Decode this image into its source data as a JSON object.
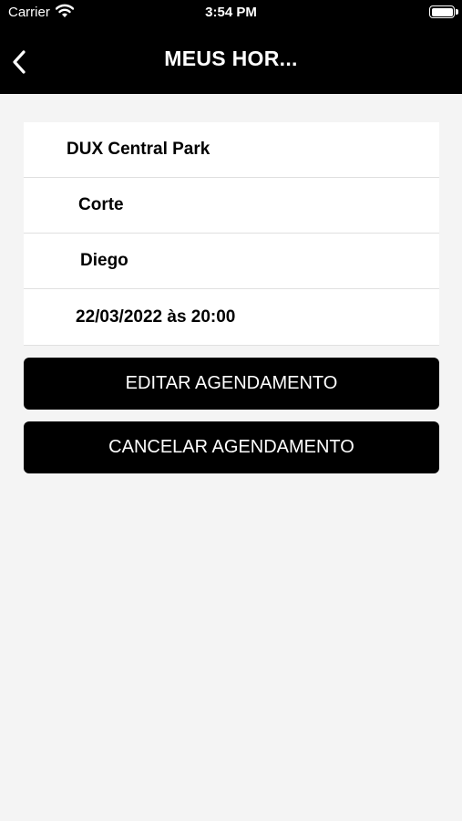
{
  "status_bar": {
    "carrier": "Carrier",
    "time": "3:54 PM",
    "wifi_icon": "wifi-icon",
    "battery_icon": "battery-icon",
    "battery_level": 1.0
  },
  "nav": {
    "title": "MEUS HOR...",
    "back_icon": "chevron-left-icon"
  },
  "details": {
    "location": "DUX Central Park",
    "service": "Corte",
    "professional": "Diego",
    "datetime": "22/03/2022 às 20:00"
  },
  "actions": {
    "edit_label": "EDITAR AGENDAMENTO",
    "cancel_label": "CANCELAR AGENDAMENTO"
  },
  "colors": {
    "header_bg": "#000000",
    "page_bg": "#f4f4f4",
    "card_bg": "#ffffff",
    "button_bg": "#000000",
    "button_text": "#ffffff"
  }
}
